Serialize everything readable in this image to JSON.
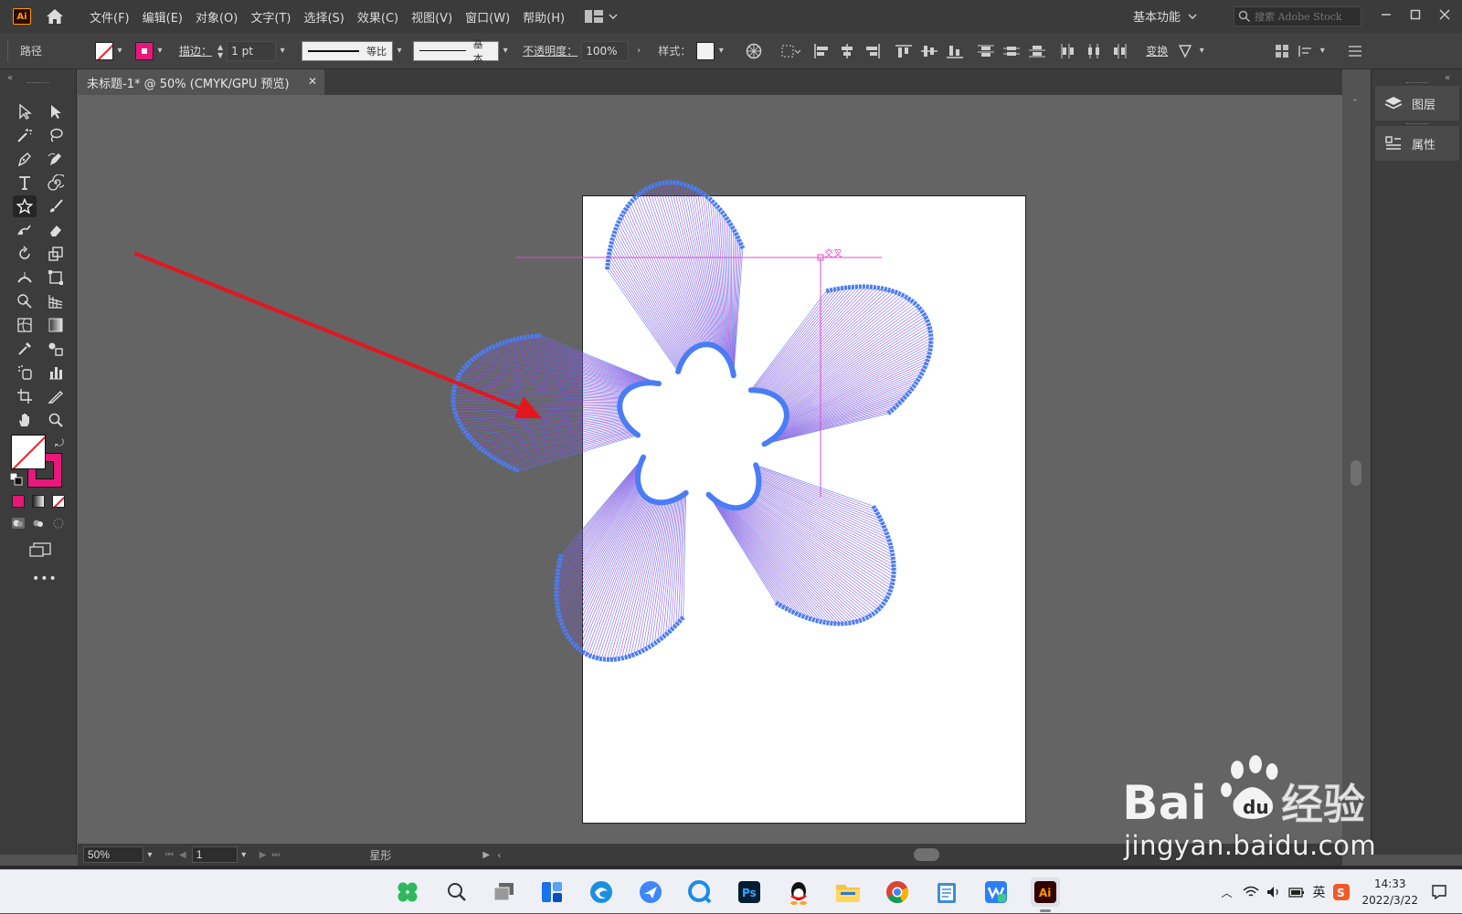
{
  "app": {
    "logo_text": "Ai"
  },
  "menu": {
    "items": [
      "文件(F)",
      "编辑(E)",
      "对象(O)",
      "文字(T)",
      "选择(S)",
      "效果(C)",
      "视图(V)",
      "窗口(W)",
      "帮助(H)"
    ],
    "workspace": "基本功能",
    "stock_search_placeholder": "搜索 Adobe Stock"
  },
  "control_bar": {
    "object_type": "路径",
    "stroke_label": "描边：",
    "stroke_weight": "1 pt",
    "stroke_profile": "等比",
    "brush_def": "基本",
    "opacity_label": "不透明度：",
    "opacity_value": "100%",
    "style_label": "样式：",
    "transform_label": "变换",
    "colors": {
      "fill": "none",
      "stroke": "#e8177a"
    }
  },
  "tools": {
    "names": [
      "selection-tool",
      "direct-selection-tool",
      "magic-wand-tool",
      "lasso-tool",
      "pen-tool",
      "curvature-tool",
      "type-tool",
      "spiral-tool",
      "star-tool",
      "paintbrush-tool",
      "shaper-tool",
      "eraser-tool",
      "rotate-tool",
      "scale-tool",
      "width-tool",
      "free-transform-tool",
      "shape-builder-tool",
      "perspective-grid-tool",
      "mesh-tool",
      "gradient-tool",
      "eyedropper-tool",
      "blend-tool",
      "symbol-sprayer-tool",
      "column-graph-tool",
      "artboard-tool",
      "slice-tool",
      "hand-tool",
      "zoom-tool"
    ],
    "active": "star-tool",
    "more_label": "•••"
  },
  "document": {
    "tab_title": "未标题-1* @ 50% (CMYK/GPU 预览)",
    "smart_guide_label": "交叉"
  },
  "right_panel": {
    "items": [
      {
        "label": "图层",
        "icon": "layers-icon"
      },
      {
        "label": "属性",
        "icon": "properties-icon"
      }
    ]
  },
  "status_bar": {
    "zoom": "50%",
    "page": "1",
    "tool_status": "星形"
  },
  "taskbar": {
    "apps": [
      "start",
      "search",
      "task-view",
      "widgets",
      "edge",
      "feishu",
      "qq-browser",
      "photoshop",
      "qq",
      "file-explorer",
      "chrome",
      "notepad",
      "wps",
      "illustrator"
    ],
    "active_app": "illustrator",
    "input_method": "英",
    "time": "14:33",
    "date": "2022/3/22"
  },
  "watermark": {
    "logo_text": "Bai 经验",
    "url": "jingyan.baidu.com"
  },
  "colors": {
    "accent_stroke": "#e8177a",
    "art_blue": "#4a7df5",
    "art_purple": "#9a4fd8",
    "arrow_red": "#e3161e",
    "guide_magenta": "#e04ad0"
  }
}
